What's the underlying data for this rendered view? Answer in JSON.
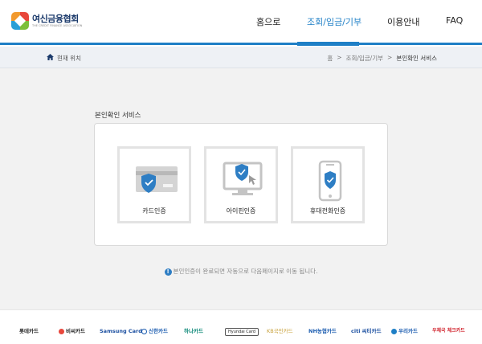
{
  "logo": {
    "name": "여신금융협회",
    "sub": "THE CREDIT FINANCE ASSOCIATION"
  },
  "nav": [
    "홈으로",
    "조회/입금/기부",
    "이용안내",
    "FAQ"
  ],
  "breadcrumb": {
    "here": "현재 위치",
    "path": [
      "홈",
      ">",
      "조회/입금/기부",
      ">",
      "본인확인 서비스"
    ]
  },
  "section_title": "본인확인 서비스",
  "cards": [
    "카드인증",
    "아이핀인증",
    "휴대전화인증"
  ],
  "notice": "본인인증이 완료되면 자동으로 다음페이지로 이동 됩니다.",
  "brands": [
    "롯데카드",
    "비씨카드",
    "Samsung Card",
    "신한카드",
    "하나카드",
    "Hyundai Card",
    "KB국민카드",
    "NH농협카드",
    "citi 씨티카드",
    "우리카드",
    "우체국 체크카드"
  ],
  "colors": {
    "accent": "#1e7fc6",
    "shield": "#2e7ec4"
  }
}
